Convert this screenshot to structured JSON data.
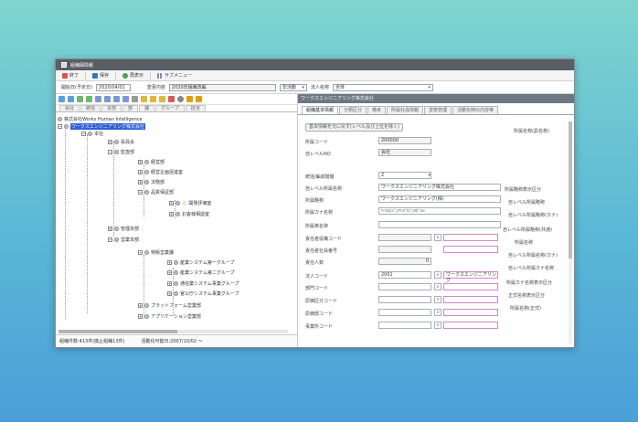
{
  "window": {
    "title": "組織図情報"
  },
  "toolbar": {
    "items": [
      "終了",
      "保存",
      "再表示",
      "サブメニュー"
    ]
  },
  "filter": {
    "start_date_label": "開始日(予定日)",
    "start_date_value": "2020/04/01",
    "content_label": "変更内容",
    "content_value": "2020年組織改編",
    "mode_value": "非活動",
    "corp_label": "法人名称",
    "corp_value": "全体"
  },
  "left_tabs": [
    "会社",
    "統括",
    "本部",
    "部",
    "課",
    "グループ",
    "担当"
  ],
  "tree": {
    "root": "株式会社Works Human Intelligence",
    "selected": "ワークスエンジニアリング株式会社",
    "nodes": [
      "本社",
      "役員会",
      "監査部",
      "経営部",
      "経営企画促進室",
      "法務部",
      "品質保証部",
      "開発評価室",
      "お客様相談室",
      "管理本部",
      "営業本部",
      "特販営業課",
      "産業システム第一グループ",
      "産業システム第二グループ",
      "通信業システム事業グループ",
      "官公庁システム事業グループ",
      "プラットフォーム営業部",
      "アプリケーション営業部"
    ]
  },
  "left_status": {
    "count": "組織件数:413件(廃止組織13件)",
    "activity": "活動化可能日:2007/10/02 ～"
  },
  "right": {
    "header": "ワークスエンジニアリング株式会社",
    "tabs": [
      "組織基本情報",
      "分類区分",
      "備考",
      "所属社員情報",
      "変数管理",
      "活動化時の内容等"
    ],
    "copy_button": "基本情報を元に戻す(レベル及び上位を除く)",
    "labels": [
      "所属コード",
      "自レベルNO",
      "統括/編成階層",
      "自レベル所属名称",
      "所属略称",
      "所属カナ名称",
      "所属英名称",
      "責任者役職コード",
      "責任者社員番号",
      "責任人数",
      "法人コード",
      "部門コード",
      "原価区分コード",
      "原価部コード",
      "事業所コード"
    ],
    "values": {
      "code": "200000",
      "level": "会社",
      "hier": "2",
      "name": "ワークスエンジニアリング株式会社",
      "short": "ワークスエンジニアリング(株)",
      "kana": "ﾜｰｸｽｴﾝｼﾞﾆｱﾘﾝｸﾞｶﾌﾞｼｷｶﾞｲｼｬ",
      "count": "0",
      "corp": "2001",
      "corp_name": "ワークスエンジニアリング"
    },
    "side_labels": [
      "所属名称(罫名称)",
      "所属略称表示区分",
      "自レベル所属略称",
      "自レベル所属略称(カナ)",
      "自レベル所属略称(共通)",
      "所属名称",
      "自レベル所属名称(カナ)",
      "自レベル所属カナ名称",
      "所属カナ名称表示区分",
      "正式名称表示区分",
      "所属名称(正式)"
    ]
  }
}
